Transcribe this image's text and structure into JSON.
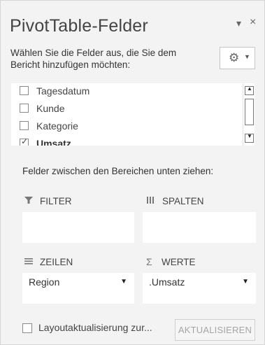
{
  "pane": {
    "title": "PivotTable-Felder",
    "dropdown_glyph": "▾",
    "close_glyph": "×",
    "instruction": "Wählen Sie die Felder aus, die Sie dem Bericht hinzufügen möchten:",
    "tools_icon": "gear-icon"
  },
  "fields": [
    {
      "label": "Tagesdatum",
      "checked": false
    },
    {
      "label": "Kunde",
      "checked": false
    },
    {
      "label": "Kategorie",
      "checked": false
    },
    {
      "label": "Umsatz",
      "checked": true
    }
  ],
  "drag_label": "Felder zwischen den Bereichen unten ziehen:",
  "areas": {
    "filter": {
      "label": "FILTER",
      "icon": "filter-icon"
    },
    "columns": {
      "label": "SPALTEN",
      "icon": "columns-icon"
    },
    "rows": {
      "label": "ZEILEN",
      "icon": "rows-icon",
      "value": "Region"
    },
    "values": {
      "label": "WERTE",
      "icon": "sigma-icon",
      "value": ".Umsatz"
    }
  },
  "footer": {
    "defer_label": "Layoutaktualisierung zur...",
    "update_button": "AKTUALISIEREN"
  }
}
